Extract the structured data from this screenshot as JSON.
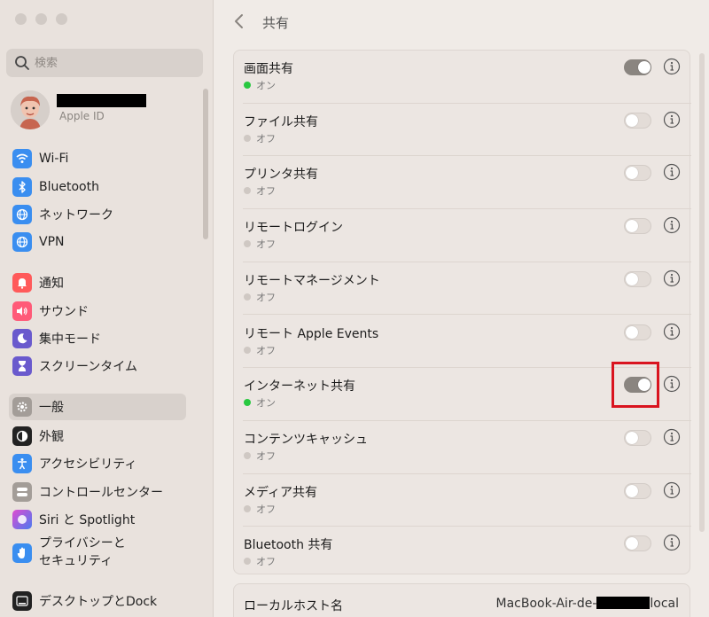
{
  "sidebar": {
    "search_placeholder": "検索",
    "profile": {
      "subtitle": "Apple ID"
    },
    "items": [
      {
        "label": "Wi-Fi",
        "icon": "wifi-icon",
        "color": "#3a8ef0"
      },
      {
        "label": "Bluetooth",
        "icon": "bluetooth-icon",
        "color": "#3a8ef0"
      },
      {
        "label": "ネットワーク",
        "icon": "globe-icon",
        "color": "#3a8ef0"
      },
      {
        "label": "VPN",
        "icon": "vpn-icon",
        "color": "#3a8ef0"
      },
      {
        "label": "通知",
        "icon": "bell-icon",
        "color": "#ff4f4f"
      },
      {
        "label": "サウンド",
        "icon": "speaker-icon",
        "color": "#ff4f6f"
      },
      {
        "label": "集中モード",
        "icon": "moon-icon",
        "color": "#6a5acd"
      },
      {
        "label": "スクリーンタイム",
        "icon": "hourglass-icon",
        "color": "#6a5acd"
      },
      {
        "label": "一般",
        "icon": "gear-icon",
        "color": "#9b9590"
      },
      {
        "label": "外観",
        "icon": "appearance-icon",
        "color": "#222222"
      },
      {
        "label": "アクセシビリティ",
        "icon": "accessibility-icon",
        "color": "#3a8ef0"
      },
      {
        "label": "コントロールセンター",
        "icon": "control-center-icon",
        "color": "#9b9590"
      },
      {
        "label": "Siri と Spotlight",
        "icon": "siri-icon",
        "color": "#b45ad8"
      },
      {
        "label": "プライバシーと\nセキュリティ",
        "label_line1": "プライバシーと",
        "label_line2": "セキュリティ",
        "icon": "hand-icon",
        "color": "#3a8ef0"
      },
      {
        "label": "デスクトップとDock",
        "icon": "dock-icon",
        "color": "#222222"
      }
    ]
  },
  "header": {
    "title": "共有"
  },
  "services": [
    {
      "name": "画面共有",
      "status": "オン",
      "on": true
    },
    {
      "name": "ファイル共有",
      "status": "オフ",
      "on": false
    },
    {
      "name": "プリンタ共有",
      "status": "オフ",
      "on": false
    },
    {
      "name": "リモートログイン",
      "status": "オフ",
      "on": false
    },
    {
      "name": "リモートマネージメント",
      "status": "オフ",
      "on": false
    },
    {
      "name": "リモート Apple Events",
      "status": "オフ",
      "on": false
    },
    {
      "name": "インターネット共有",
      "status": "オン",
      "on": true
    },
    {
      "name": "コンテンツキャッシュ",
      "status": "オフ",
      "on": false
    },
    {
      "name": "メディア共有",
      "status": "オフ",
      "on": false
    },
    {
      "name": "Bluetooth 共有",
      "status": "オフ",
      "on": false
    }
  ],
  "local_host": {
    "label": "ローカルホスト名",
    "value_prefix": "MacBook-Air-de-",
    "value_suffix": "local"
  }
}
